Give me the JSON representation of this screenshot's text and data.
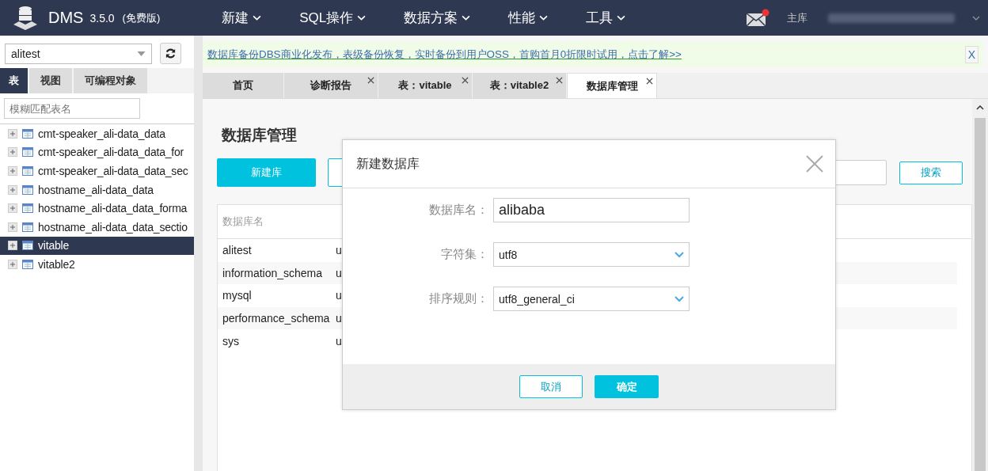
{
  "header": {
    "app_name": "DMS",
    "version": "3.5.0",
    "edition": "(免费版)",
    "menu": [
      {
        "label": "新建"
      },
      {
        "label": "SQL操作"
      },
      {
        "label": "数据方案"
      },
      {
        "label": "性能"
      },
      {
        "label": "工具"
      }
    ],
    "notification": {
      "unread": true
    },
    "role": "主库"
  },
  "sidebar": {
    "database": "alitest",
    "tabs": [
      {
        "label": "表",
        "selected": true
      },
      {
        "label": "视图",
        "selected": false
      },
      {
        "label": "可编程对象",
        "selected": false
      }
    ],
    "filter": {
      "placeholder": "模糊匹配表名"
    },
    "tables": [
      {
        "name": "cmt-speaker_ali-data_data",
        "selected": false
      },
      {
        "name": "cmt-speaker_ali-data_data_for",
        "selected": false
      },
      {
        "name": "cmt-speaker_ali-data_data_sec",
        "selected": false
      },
      {
        "name": "hostname_ali-data_data",
        "selected": false
      },
      {
        "name": "hostname_ali-data_data_forma",
        "selected": false
      },
      {
        "name": "hostname_ali-data_data_sectio",
        "selected": false
      },
      {
        "name": "vitable",
        "selected": true
      },
      {
        "name": "vitable2",
        "selected": false
      }
    ]
  },
  "banner": {
    "text": "数据库备份DBS商业化发布，表级备份恢复，实时备份到用户OSS，首购首月0折限时试用，点击了解>>",
    "close": "X"
  },
  "tabs": [
    {
      "label": "首页",
      "selected": false,
      "closable": false
    },
    {
      "label": "诊断报告",
      "selected": false,
      "closable": true
    },
    {
      "label": "表：vitable",
      "selected": false,
      "closable": true
    },
    {
      "label": "表：vitable2",
      "selected": false,
      "closable": true
    },
    {
      "label": "数据库管理",
      "selected": true,
      "closable": true
    }
  ],
  "page": {
    "title": "数据库管理",
    "new_button": "新建库",
    "search_button": "搜索",
    "table": {
      "columns": [
        "数据库名"
      ],
      "rows": [
        [
          "alitest",
          "u"
        ],
        [
          "information_schema",
          "u"
        ],
        [
          "mysql",
          "u"
        ],
        [
          "performance_schema",
          "u"
        ],
        [
          "sys",
          "u"
        ]
      ]
    }
  },
  "dialog": {
    "title": "新建数据库",
    "fields": [
      {
        "label": "数据库名：",
        "kind": "text",
        "value": "alibaba"
      },
      {
        "label": "字符集：",
        "kind": "select",
        "value": "utf8"
      },
      {
        "label": "排序规则：",
        "kind": "select",
        "value": "utf8_general_ci"
      }
    ],
    "cancel": "取消",
    "ok": "确定"
  }
}
